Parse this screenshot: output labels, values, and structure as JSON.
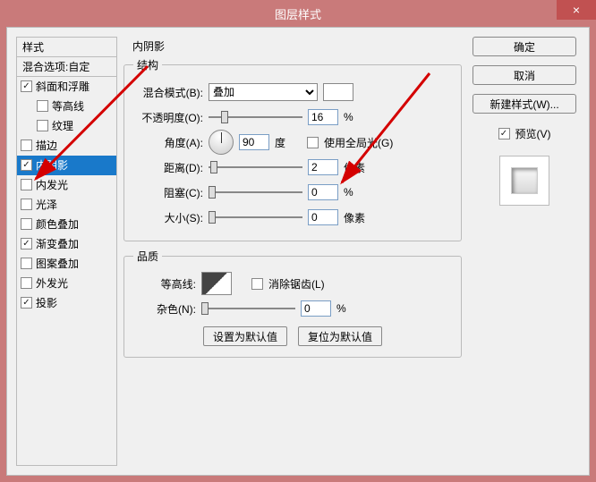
{
  "window": {
    "title": "图层样式",
    "close": "×"
  },
  "sidebar": {
    "header": "样式",
    "blend": "混合选项:自定",
    "items": [
      {
        "label": "斜面和浮雕",
        "checked": true,
        "sub": false
      },
      {
        "label": "等高线",
        "checked": false,
        "sub": true
      },
      {
        "label": "纹理",
        "checked": false,
        "sub": true
      },
      {
        "label": "描边",
        "checked": false,
        "sub": false
      },
      {
        "label": "内阴影",
        "checked": true,
        "sub": false,
        "selected": true
      },
      {
        "label": "内发光",
        "checked": false,
        "sub": false
      },
      {
        "label": "光泽",
        "checked": false,
        "sub": false
      },
      {
        "label": "颜色叠加",
        "checked": false,
        "sub": false
      },
      {
        "label": "渐变叠加",
        "checked": true,
        "sub": false
      },
      {
        "label": "图案叠加",
        "checked": false,
        "sub": false
      },
      {
        "label": "外发光",
        "checked": false,
        "sub": false
      },
      {
        "label": "投影",
        "checked": true,
        "sub": false
      }
    ]
  },
  "panel": {
    "title": "内阴影",
    "structure": {
      "legend": "结构",
      "blendmode_label": "混合模式(B):",
      "blendmode_value": "叠加",
      "opacity_label": "不透明度(O):",
      "opacity_value": "16",
      "opacity_unit": "%",
      "angle_label": "角度(A):",
      "angle_value": "90",
      "angle_unit": "度",
      "global_label": "使用全局光(G)",
      "distance_label": "距离(D):",
      "distance_value": "2",
      "distance_unit": "像素",
      "choke_label": "阻塞(C):",
      "choke_value": "0",
      "choke_unit": "%",
      "size_label": "大小(S):",
      "size_value": "0",
      "size_unit": "像素"
    },
    "quality": {
      "legend": "品质",
      "contour_label": "等高线:",
      "antialias_label": "消除锯齿(L)",
      "noise_label": "杂色(N):",
      "noise_value": "0",
      "noise_unit": "%"
    },
    "buttons": {
      "set_default": "设置为默认值",
      "reset_default": "复位为默认值"
    }
  },
  "right": {
    "ok": "确定",
    "cancel": "取消",
    "new_style": "新建样式(W)...",
    "preview_label": "预览(V)",
    "preview_checked": true
  }
}
